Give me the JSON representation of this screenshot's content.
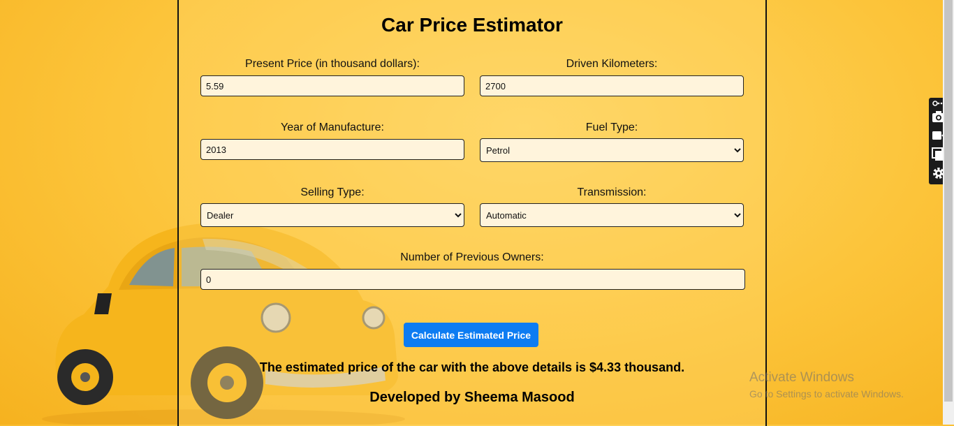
{
  "app": {
    "title": "Car Price Estimator",
    "form": {
      "present_price": {
        "label": "Present Price (in thousand dollars):",
        "value": "5.59"
      },
      "driven_km": {
        "label": "Driven Kilometers:",
        "value": "2700"
      },
      "year": {
        "label": "Year of Manufacture:",
        "value": "2013"
      },
      "fuel_type": {
        "label": "Fuel Type:",
        "selected": "Petrol"
      },
      "selling_type": {
        "label": "Selling Type:",
        "selected": "Dealer"
      },
      "transmission": {
        "label": "Transmission:",
        "selected": "Automatic"
      },
      "owners": {
        "label": "Number of Previous Owners:",
        "value": "0"
      }
    },
    "calculate_button": "Calculate Estimated Price",
    "result_text": "The estimated price of the car with the above details is $4.33 thousand.",
    "credit": "Developed by Sheema Masood"
  },
  "watermark": {
    "line1": "Activate Windows",
    "line2": "Go to Settings to activate Windows."
  },
  "side_toolbar": {
    "icons": [
      "link-icon",
      "more-icon",
      "camera-icon",
      "video-icon",
      "copy-icon",
      "gear-icon"
    ]
  },
  "colors": {
    "accent": "#0d7cf2",
    "background": "#fcc43a",
    "field_bg": "#fff4dc"
  }
}
